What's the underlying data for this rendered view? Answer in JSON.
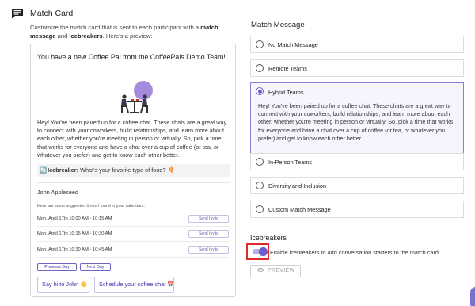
{
  "section": {
    "title": "Match Card",
    "desc_part1": "Customize the match card that is sent to each participant with a ",
    "desc_bold1": "match message",
    "desc_part2": " and ",
    "desc_bold2": "Icebreakers",
    "desc_part3": ". Here's a preview:"
  },
  "card": {
    "header": "You have a new Coffee Pal from the CoffeePals Demo Team!",
    "intro": "Hey! You've been paired up for a coffee chat. These chats are a great way to connect with your coworkers, build relationships, and learn more about each other, whether you're meeting in person or virtually. So, pick a time that works for everyone and have a chat over a cup of coffee (or tea, or whatever you prefer) and get to know each other better.",
    "icebreaker_icon": "🔄",
    "icebreaker_label": "Icebreaker:",
    "icebreaker_text": " What's your favorite type of food? 🍕",
    "user_name": "John Appleseed",
    "suggested": "Here are some suggested times I found in your calendars:",
    "times": [
      {
        "label": "Mon, April 17th 10:00 AM - 10:15 AM",
        "button": "Send Invite"
      },
      {
        "label": "Mon, April 17th 10:15 AM - 10:30 AM",
        "button": "Send Invite"
      },
      {
        "label": "Mon, April 17th 10:30 AM - 10:45 AM",
        "button": "Send Invite"
      }
    ],
    "previous_day": "Previous Day",
    "next_day": "Next Day",
    "say_hi": "Say hi to John 👋",
    "schedule": "Schedule your coffee chat 📅"
  },
  "match_message": {
    "title": "Match Message",
    "options": [
      {
        "label": "No Match Message"
      },
      {
        "label": "Remote Teams"
      },
      {
        "label": "Hybrid Teams",
        "text": "Hey! You've been paired up for a coffee chat. These chats are a great way to connect with your coworkers, build relationships, and learn more about each other, whether you're meeting in person or virtually. So, pick a time that works for everyone and have a chat over a cup of coffee (or tea, or whatever you prefer) and get to know each other better."
      },
      {
        "label": "In-Person Teams"
      },
      {
        "label": "Diversity and Inclusion"
      },
      {
        "label": "Custom Match Message"
      }
    ],
    "selected": "Hybrid Teams"
  },
  "icebreakers": {
    "title": "Icebreakers",
    "toggle_label": "Enable icebreakers to add conversation starters to the match card.",
    "enabled": true,
    "preview_button": "PREVIEW"
  },
  "colors": {
    "accent": "#6a5ecb",
    "highlight_border": "#e02a2a"
  },
  "icons": [
    "chat-icon",
    "eye-icon"
  ]
}
